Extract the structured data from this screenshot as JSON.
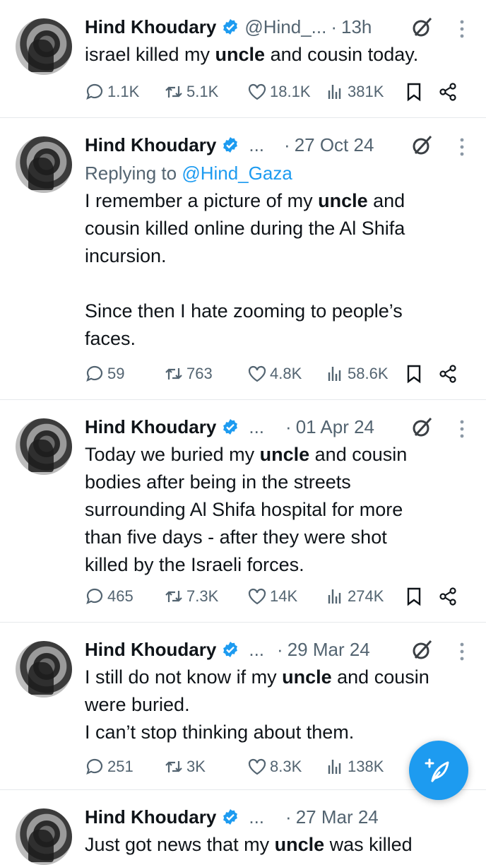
{
  "tweets": [
    {
      "name": "Hind Khoudary",
      "handle": "@Hind_...",
      "dot": "·",
      "time": "13h",
      "reply_prefix": "",
      "reply_mention": "",
      "text_parts": [
        {
          "t": "israel killed my ",
          "b": false
        },
        {
          "t": "uncle",
          "b": true
        },
        {
          "t": " and cousin today.",
          "b": false
        }
      ],
      "stats": {
        "replies": "1.1K",
        "reposts": "5.1K",
        "likes": "18.1K",
        "views": "381K"
      }
    },
    {
      "name": "Hind Khoudary",
      "handle": "...",
      "dot": "·",
      "time": "27 Oct 24",
      "reply_prefix": "Replying to ",
      "reply_mention": "@Hind_Gaza",
      "text_parts": [
        {
          "t": "I remember a picture of my ",
          "b": false
        },
        {
          "t": "uncle",
          "b": true
        },
        {
          "t": " and\ncousin killed online during the Al Shifa\nincursion.\n\nSince then I hate zooming to people’s\nfaces.",
          "b": false
        }
      ],
      "stats": {
        "replies": "59",
        "reposts": "763",
        "likes": "4.8K",
        "views": "58.6K"
      }
    },
    {
      "name": "Hind Khoudary",
      "handle": "...",
      "dot": "·",
      "time": "01 Apr 24",
      "reply_prefix": "",
      "reply_mention": "",
      "text_parts": [
        {
          "t": "Today we buried my ",
          "b": false
        },
        {
          "t": "uncle",
          "b": true
        },
        {
          "t": " and cousin\nbodies after being in the streets\nsurrounding Al Shifa hospital for more\nthan five days - after they were shot\nkilled by the Israeli forces.",
          "b": false
        }
      ],
      "stats": {
        "replies": "465",
        "reposts": "7.3K",
        "likes": "14K",
        "views": "274K"
      }
    },
    {
      "name": "Hind Khoudary",
      "handle": "...",
      "dot": "·",
      "time": "29 Mar 24",
      "reply_prefix": "",
      "reply_mention": "",
      "text_parts": [
        {
          "t": "I still do not know if my ",
          "b": false
        },
        {
          "t": "uncle",
          "b": true
        },
        {
          "t": " and cousin\nwere buried.\nI can’t stop thinking about them.",
          "b": false
        }
      ],
      "stats": {
        "replies": "251",
        "reposts": "3K",
        "likes": "8.3K",
        "views": "138K"
      }
    },
    {
      "name": "Hind Khoudary",
      "handle": "...",
      "dot": "·",
      "time": "27 Mar 24",
      "reply_prefix": "",
      "reply_mention": "",
      "text_parts": [
        {
          "t": "Just got news that my ",
          "b": false
        },
        {
          "t": "uncle",
          "b": true
        },
        {
          "t": " was killed",
          "b": false
        }
      ],
      "stats": {
        "replies": "",
        "reposts": "",
        "likes": "",
        "views": ""
      }
    }
  ],
  "colors": {
    "accent": "#1d9bf0",
    "muted": "#536471",
    "text": "#0f1419",
    "verified": "#1d9bf0"
  },
  "icons": {
    "compose": "compose-icon",
    "verified": "verified-badge-icon",
    "grok": "grok-icon",
    "more": "more-vertical-icon"
  }
}
